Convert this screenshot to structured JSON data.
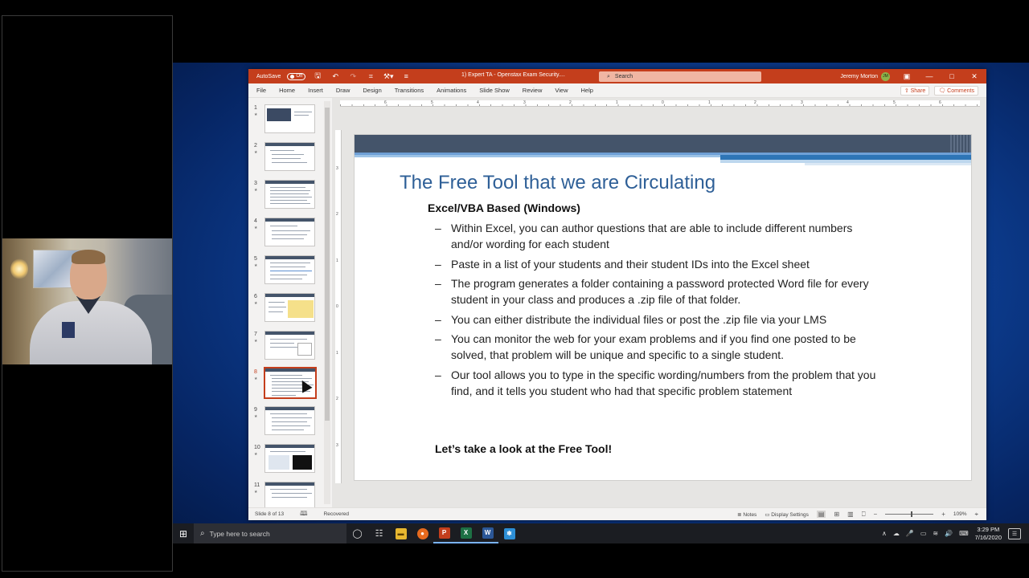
{
  "powerpoint": {
    "autosave_label": "AutoSave",
    "autosave_state": "Off",
    "doc_title": "1) Expert TA - Openstax Exam Security....",
    "search_placeholder": "Search",
    "user_name": "Jeremy Morton",
    "user_initials": "JM",
    "menu": [
      "File",
      "Home",
      "Insert",
      "Draw",
      "Design",
      "Transitions",
      "Animations",
      "Slide Show",
      "Review",
      "View",
      "Help"
    ],
    "share_label": "Share",
    "comments_label": "Comments",
    "accent_color": "#c43e1c"
  },
  "thumbnails": {
    "numbers": [
      "1",
      "2",
      "3",
      "4",
      "5",
      "6",
      "7",
      "8",
      "9",
      "10",
      "11"
    ],
    "selected": "8"
  },
  "ruler": {
    "h_ticks": [
      "6",
      "5",
      "4",
      "3",
      "2",
      "1",
      "0",
      "1",
      "2",
      "3",
      "4",
      "5",
      "6"
    ],
    "v_ticks": [
      "3",
      "2",
      "1",
      "0",
      "1",
      "2",
      "3"
    ]
  },
  "slide": {
    "title": "The Free Tool that we are Circulating",
    "subhead": "Excel/VBA Based (Windows)",
    "bullets": [
      "Within Excel, you can author questions that are able to include different numbers and/or wording for each student",
      "Paste in a list of your students and their student IDs into the Excel sheet",
      "The program generates a folder containing a password protected Word file for every student in your class and produces a .zip file of that folder.",
      "You can either distribute the individual files or post the .zip file via your LMS",
      "You can monitor the web for your exam problems and if you find one posted to be solved, that problem will be unique and specific to a single student.",
      "Our tool allows you to type in the specific wording/numbers from the problem that you find, and it tells you student who had that specific problem statement"
    ],
    "closing": "Let’s take a look at the Free Tool!"
  },
  "statusbar": {
    "slide_info": "Slide 8 of 13",
    "recovered": "Recovered",
    "notes": "Notes",
    "display_settings": "Display Settings",
    "zoom": "109%"
  },
  "taskbar": {
    "search_placeholder": "Type here to search",
    "time": "3:29 PM",
    "date": "7/16/2020"
  }
}
